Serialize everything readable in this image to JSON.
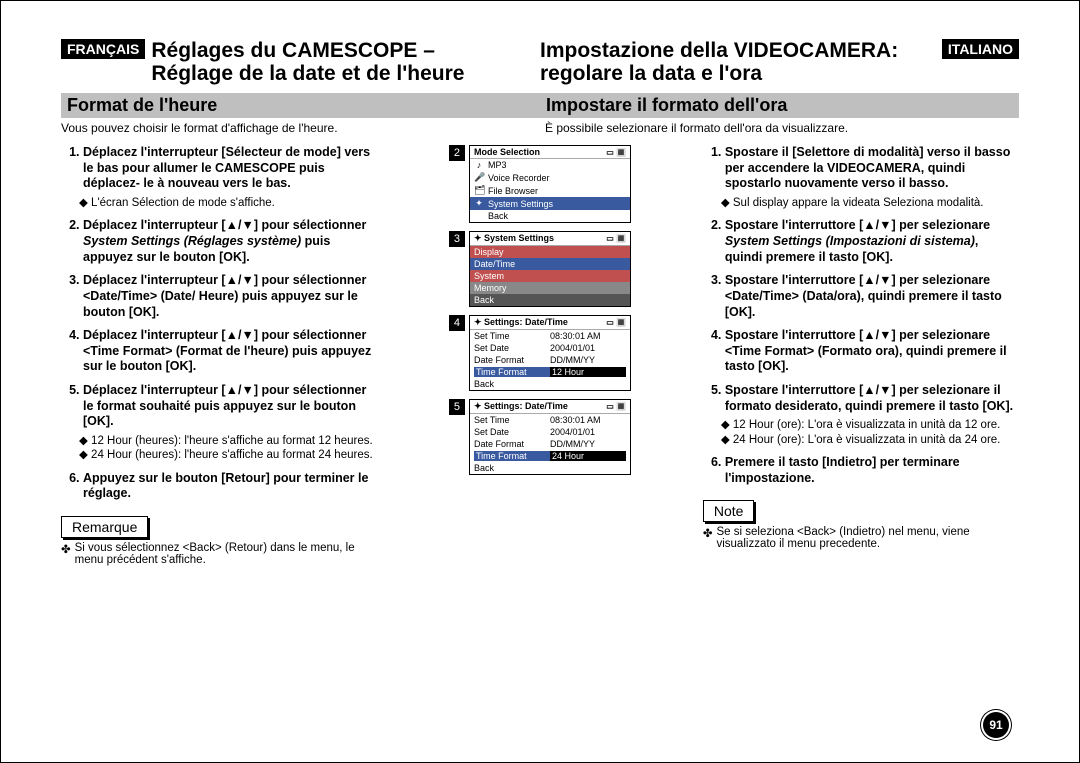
{
  "page_number": "91",
  "fr": {
    "lang": "FRANÇAIS",
    "title1": "Réglages du CAMESCOPE –",
    "title2": "Réglage de la date et de l'heure",
    "subtitle": "Format de l'heure",
    "intro": "Vous pouvez choisir le format d'affichage de l'heure.",
    "step1": "Déplacez l'interrupteur [Sélecteur de mode] vers le bas pour allumer le CAMESCOPE puis déplacez- le à nouveau vers le bas.",
    "step1_sub": "L'écran Sélection de mode s'affiche.",
    "step2a": "Déplacez l'interrupteur [",
    "step2b": "] pour sélectionner ",
    "step2_em": "System Settings (Réglages système)",
    "step2c": " puis appuyez sur le bouton [OK].",
    "step3a": "Déplacez l'interrupteur [",
    "step3b": "] pour sélectionner <Date/Time> (Date/ Heure) puis appuyez sur le bouton [OK].",
    "step4a": "Déplacez l'interrupteur [",
    "step4b": "] pour sélectionner <Time Format> (Format de l'heure) puis appuyez sur le bouton [OK].",
    "step5a": "Déplacez l'interrupteur [",
    "step5b": "] pour sélectionner le format souhaité puis appuyez sur le bouton [OK].",
    "b5_1": "12 Hour (heures): l'heure s'affiche au format 12 heures.",
    "b5_2": "24 Hour (heures): l'heure s'affiche au format 24 heures.",
    "step6": "Appuyez sur le bouton [Retour] pour terminer le réglage.",
    "note_label": "Remarque",
    "note_text": "Si vous sélectionnez <Back> (Retour) dans le menu, le menu précédent s'affiche."
  },
  "it": {
    "lang": "ITALIANO",
    "title1": "Impostazione della VIDEOCAMERA:",
    "title2": "regolare la data e l'ora",
    "subtitle": "Impostare il formato dell'ora",
    "intro": "È possibile selezionare il formato dell'ora da visualizzare.",
    "step1": "Spostare il [Selettore di modalità] verso il basso per accendere la VIDEOCAMERA, quindi spostarlo nuovamente verso il basso.",
    "step1_sub": "Sul display appare la videata Seleziona modalità.",
    "step2a": "Spostare l'interruttore [",
    "step2b": "] per selezionare ",
    "step2_em": "System Settings (Impostazioni di sistema)",
    "step2c": ", quindi premere il tasto [OK].",
    "step3a": "Spostare l'interruttore [",
    "step3b": "] per selezionare <Date/Time> (Data/ora), quindi premere il tasto [OK].",
    "step4a": "Spostare l'interruttore [",
    "step4b": "] per selezionare <Time Format> (Formato ora), quindi premere il tasto [OK].",
    "step5a": "Spostare l'interruttore [",
    "step5b": "] per selezionare il formato desiderato, quindi premere il tasto [OK].",
    "b5_1": "12 Hour (ore): L'ora è visualizzata in unità da 12 ore.",
    "b5_2": "24 Hour (ore): L'ora è visualizzata in unità da 24 ore.",
    "step6": "Premere il tasto [Indietro] per terminare l'impostazione.",
    "note_label": "Note",
    "note_text": "Se si seleziona <Back> (Indietro) nel menu, viene visualizzato il menu precedente."
  },
  "arrows": "▲/▼",
  "screens": {
    "s2": {
      "title": "Mode Selection",
      "items": [
        "MP3",
        "Voice Recorder",
        "File Browser",
        "System Settings",
        "Back"
      ],
      "selected": "System Settings",
      "icons": [
        "♪",
        "🎤",
        "🗂",
        "✦",
        ""
      ]
    },
    "s3": {
      "title": "System Settings",
      "items": [
        "Display",
        "Date/Time",
        "System",
        "Memory",
        "Back"
      ],
      "selected": "Date/Time"
    },
    "s4": {
      "title": "Settings: Date/Time",
      "rows": [
        {
          "k": "Set Time",
          "v": "08:30:01 AM"
        },
        {
          "k": "Set Date",
          "v": "2004/01/01"
        },
        {
          "k": "Date Format",
          "v": "DD/MM/YY"
        },
        {
          "k": "Time Format",
          "v": "12 Hour",
          "sel": true
        },
        {
          "k": "Back",
          "v": ""
        }
      ]
    },
    "s5": {
      "title": "Settings: Date/Time",
      "rows": [
        {
          "k": "Set Time",
          "v": "08:30:01 AM"
        },
        {
          "k": "Set Date",
          "v": "2004/01/01"
        },
        {
          "k": "Date Format",
          "v": "DD/MM/YY"
        },
        {
          "k": "Time Format",
          "v": "24 Hour",
          "sel": true
        },
        {
          "k": "Back",
          "v": ""
        }
      ]
    }
  }
}
